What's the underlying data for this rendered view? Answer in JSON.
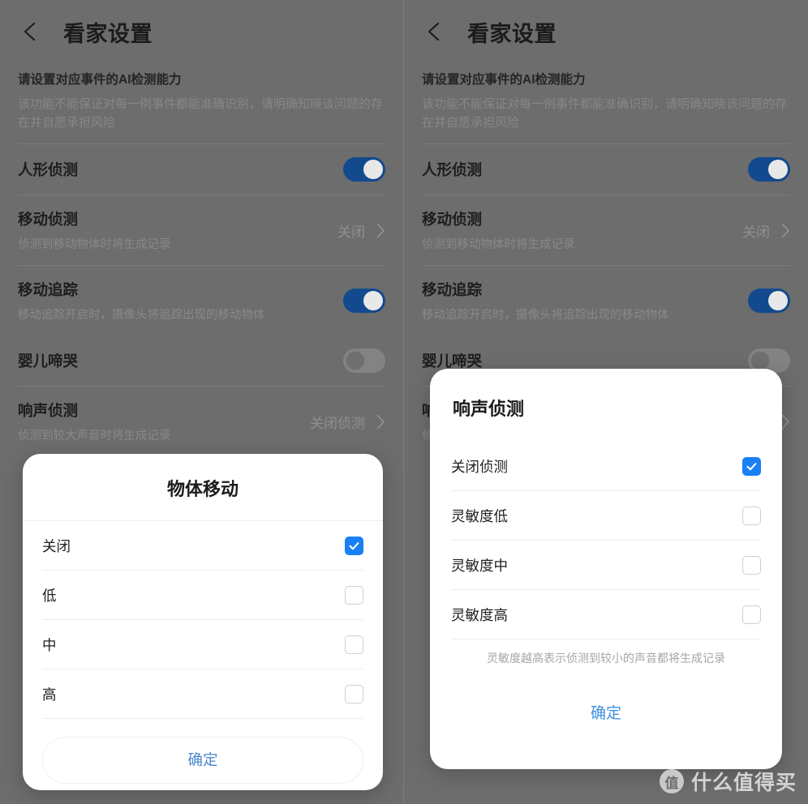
{
  "header": {
    "back_icon": "arrow-left-icon",
    "title": "看家设置"
  },
  "intro": {
    "title": "请设置对应事件的AI检测能力",
    "desc": "该功能不能保证对每一例事件都能准确识别，请明确知晓该问题的存在并自愿承担风险"
  },
  "settings_rows": [
    {
      "title": "人形侦测",
      "sub": "",
      "control": "toggle",
      "state": "on",
      "value": ""
    },
    {
      "title": "移动侦测",
      "sub": "侦测到移动物体时将生成记录",
      "control": "value-chevron",
      "state": "",
      "value": "关闭"
    },
    {
      "title": "移动追踪",
      "sub": "移动追踪开启时，摄像头将追踪出现的移动物体",
      "control": "toggle",
      "state": "on",
      "value": ""
    },
    {
      "title": "婴儿啼哭",
      "sub": "",
      "control": "toggle",
      "state": "off",
      "value": ""
    },
    {
      "title": "响声侦测",
      "sub": "侦测到较大声音时将生成记录",
      "control": "value-chevron",
      "state": "",
      "value": "关闭侦测"
    }
  ],
  "left_dialog": {
    "title": "物体移动",
    "options": [
      {
        "label": "关闭",
        "checked": true
      },
      {
        "label": "低",
        "checked": false
      },
      {
        "label": "中",
        "checked": false
      },
      {
        "label": "高",
        "checked": false
      }
    ],
    "confirm_label": "确定"
  },
  "right_dialog": {
    "title": "响声侦测",
    "options": [
      {
        "label": "关闭侦测",
        "checked": true
      },
      {
        "label": "灵敏度低",
        "checked": false
      },
      {
        "label": "灵敏度中",
        "checked": false
      },
      {
        "label": "灵敏度高",
        "checked": false
      }
    ],
    "hint": "灵敏度越高表示侦测到较小的声音都将生成记录",
    "confirm_label": "确定"
  },
  "watermark": {
    "badge": "值",
    "text": "什么值得买"
  },
  "colors": {
    "accent_checkbox": "#1a80f5",
    "toggle_on": "#134a8e",
    "toggle_off": "#838383",
    "confirm_text": "#3e90e0",
    "panel_bg": "#6d6d6d"
  }
}
